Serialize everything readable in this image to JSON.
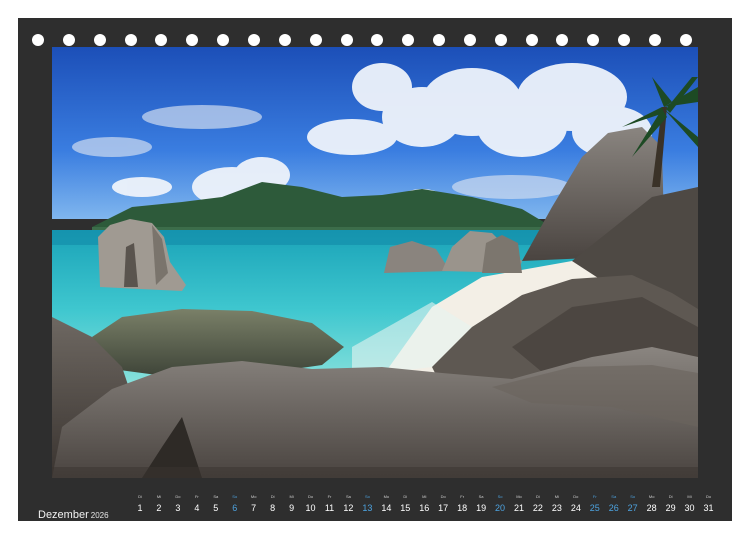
{
  "calendar": {
    "month": "Dezember",
    "year": "2026",
    "days": [
      {
        "num": "1",
        "wd": "Di",
        "sun": false
      },
      {
        "num": "2",
        "wd": "Mi",
        "sun": false
      },
      {
        "num": "3",
        "wd": "Do",
        "sun": false
      },
      {
        "num": "4",
        "wd": "Fr",
        "sun": false
      },
      {
        "num": "5",
        "wd": "Sa",
        "sun": false
      },
      {
        "num": "6",
        "wd": "So",
        "sun": true
      },
      {
        "num": "7",
        "wd": "Mo",
        "sun": false
      },
      {
        "num": "8",
        "wd": "Di",
        "sun": false
      },
      {
        "num": "9",
        "wd": "Mi",
        "sun": false
      },
      {
        "num": "10",
        "wd": "Do",
        "sun": false
      },
      {
        "num": "11",
        "wd": "Fr",
        "sun": false
      },
      {
        "num": "12",
        "wd": "Sa",
        "sun": false
      },
      {
        "num": "13",
        "wd": "So",
        "sun": true
      },
      {
        "num": "14",
        "wd": "Mo",
        "sun": false
      },
      {
        "num": "15",
        "wd": "Di",
        "sun": false
      },
      {
        "num": "16",
        "wd": "Mi",
        "sun": false
      },
      {
        "num": "17",
        "wd": "Do",
        "sun": false
      },
      {
        "num": "18",
        "wd": "Fr",
        "sun": false
      },
      {
        "num": "19",
        "wd": "Sa",
        "sun": false
      },
      {
        "num": "20",
        "wd": "So",
        "sun": true
      },
      {
        "num": "21",
        "wd": "Mo",
        "sun": false
      },
      {
        "num": "22",
        "wd": "Di",
        "sun": false
      },
      {
        "num": "23",
        "wd": "Mi",
        "sun": false
      },
      {
        "num": "24",
        "wd": "Do",
        "sun": false
      },
      {
        "num": "25",
        "wd": "Fr",
        "sun": true
      },
      {
        "num": "26",
        "wd": "Sa",
        "sun": true
      },
      {
        "num": "27",
        "wd": "So",
        "sun": true
      },
      {
        "num": "28",
        "wd": "Mo",
        "sun": false
      },
      {
        "num": "29",
        "wd": "Di",
        "sun": false
      },
      {
        "num": "30",
        "wd": "Mi",
        "sun": false
      },
      {
        "num": "31",
        "wd": "Do",
        "sun": false
      }
    ]
  },
  "colors": {
    "frame": "#2e2e2e",
    "highlight": "#4da3e0",
    "binding_hole": "#ffffff"
  },
  "binding_hole_count": 22
}
